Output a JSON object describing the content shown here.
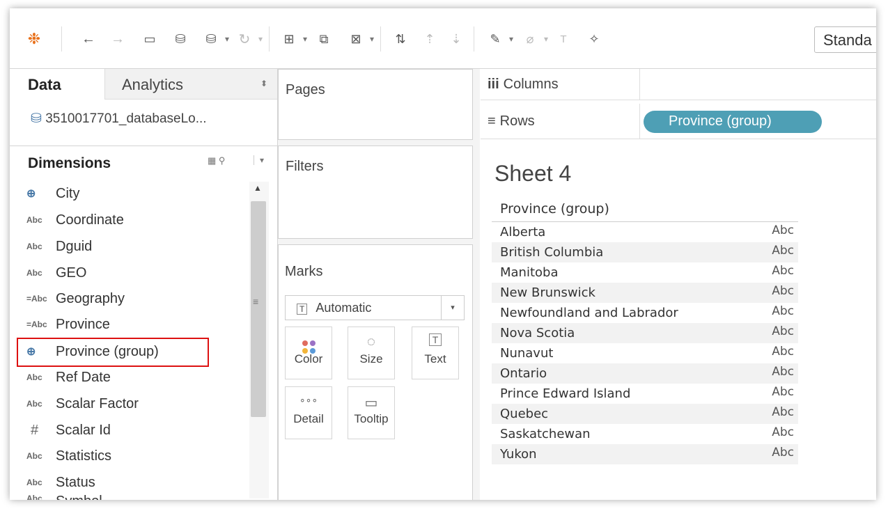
{
  "toolbar": {
    "style_select": "Standa"
  },
  "data_pane": {
    "tab_data": "Data",
    "tab_analytics": "Analytics",
    "datasource": "3510017701_databaseLo...",
    "dimensions_title": "Dimensions",
    "fields": [
      {
        "icon": "⊕",
        "type": "geo",
        "label": "City"
      },
      {
        "icon": "Abc",
        "type": "string",
        "label": "Coordinate"
      },
      {
        "icon": "Abc",
        "type": "string",
        "label": "Dguid"
      },
      {
        "icon": "Abc",
        "type": "string",
        "label": "GEO"
      },
      {
        "icon": "=Abc",
        "type": "string-calc",
        "label": "Geography"
      },
      {
        "icon": "=Abc",
        "type": "string-calc",
        "label": "Province"
      },
      {
        "icon": "⊕",
        "type": "group",
        "label": "Province (group)"
      },
      {
        "icon": "Abc",
        "type": "string",
        "label": "Ref Date"
      },
      {
        "icon": "Abc",
        "type": "string",
        "label": "Scalar Factor"
      },
      {
        "icon": "#",
        "type": "number",
        "label": "Scalar Id"
      },
      {
        "icon": "Abc",
        "type": "string",
        "label": "Statistics"
      },
      {
        "icon": "Abc",
        "type": "string",
        "label": "Status"
      },
      {
        "icon": "Abc",
        "type": "string",
        "label": "Symbol"
      }
    ]
  },
  "cards": {
    "pages": "Pages",
    "filters": "Filters",
    "marks": "Marks",
    "mark_type": "Automatic",
    "mark_buttons": [
      "Color",
      "Size",
      "Text",
      "Detail",
      "Tooltip"
    ]
  },
  "shelves": {
    "columns": "Columns",
    "rows": "Rows",
    "rows_pill": "Province (group)"
  },
  "view": {
    "sheet_title": "Sheet 4",
    "header": "Province (group)",
    "rows": [
      {
        "name": "Alberta",
        "value": "Abc"
      },
      {
        "name": "British Columbia",
        "value": "Abc"
      },
      {
        "name": "Manitoba",
        "value": "Abc"
      },
      {
        "name": "New Brunswick",
        "value": "Abc"
      },
      {
        "name": "Newfoundland and Labrador",
        "value": "Abc"
      },
      {
        "name": "Nova Scotia",
        "value": "Abc"
      },
      {
        "name": "Nunavut",
        "value": "Abc"
      },
      {
        "name": "Ontario",
        "value": "Abc"
      },
      {
        "name": "Prince Edward Island",
        "value": "Abc"
      },
      {
        "name": "Quebec",
        "value": "Abc"
      },
      {
        "name": "Saskatchewan",
        "value": "Abc"
      },
      {
        "name": "Yukon",
        "value": "Abc"
      }
    ]
  },
  "colors": {
    "pill": "#4e9fb5",
    "highlight": "#dd1111"
  }
}
